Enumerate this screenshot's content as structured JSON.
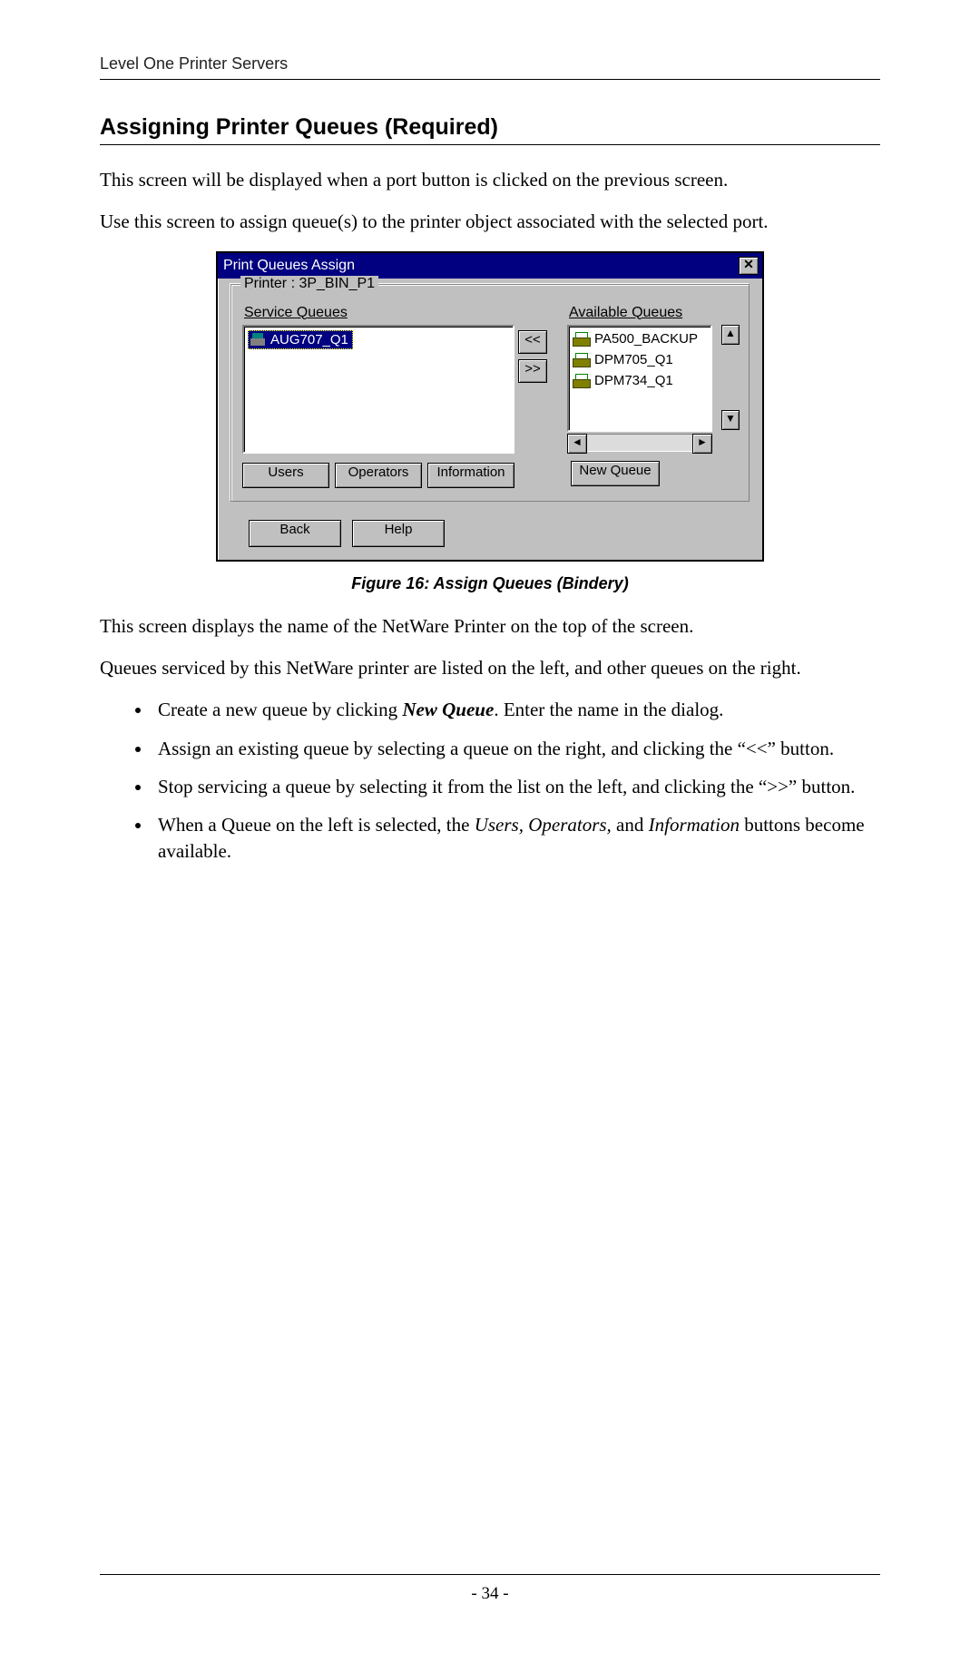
{
  "header": {
    "running_title": "Level One Printer Servers"
  },
  "section": {
    "title": "Assigning Printer Queues (Required)"
  },
  "intro": {
    "p1": "This screen will be displayed when a port button is clicked on the previous screen.",
    "p2": "Use this screen to assign queue(s) to the printer object associated with the selected port."
  },
  "dialog": {
    "title": "Print Queues Assign",
    "close_glyph": "✕",
    "group_legend": "Printer : 3P_BIN_P1",
    "service_label": "Service Queues",
    "service_items": [
      "AUG707_Q1"
    ],
    "move_left": "<<",
    "move_right": ">>",
    "available_label": "Available Queues",
    "available_items": [
      "PA500_BACKUP",
      "DPM705_Q1",
      "DPM734_Q1"
    ],
    "scroll": {
      "up": "▲",
      "down": "▼",
      "left": "◄",
      "right": "►"
    },
    "buttons": {
      "users": "Users",
      "operators": "Operators",
      "information": "Information",
      "new_queue": "New Queue",
      "back": "Back",
      "help": "Help"
    }
  },
  "figure_caption": "Figure 16: Assign Queues (Bindery)",
  "after": {
    "p1": "This screen displays the name of the NetWare Printer on the top of the screen.",
    "p2": "Queues serviced by this NetWare printer are listed on the left, and other queues on the right."
  },
  "bullets": {
    "b1_a": "Create a new queue by clicking ",
    "b1_em": "New Queue",
    "b1_b": ". Enter the name in the dialog.",
    "b2": "Assign an existing queue by selecting a queue on the right, and clicking the “<<” button.",
    "b3": "Stop servicing a queue by selecting it from the list on the left, and clicking the “>>” button.",
    "b4_a": "When a Queue on the left is selected, the ",
    "b4_em": "Users, Operators,",
    "b4_b": " and ",
    "b4_em2": "Information",
    "b4_c": " buttons become available."
  },
  "footer": {
    "page_no": "- 34 -"
  }
}
